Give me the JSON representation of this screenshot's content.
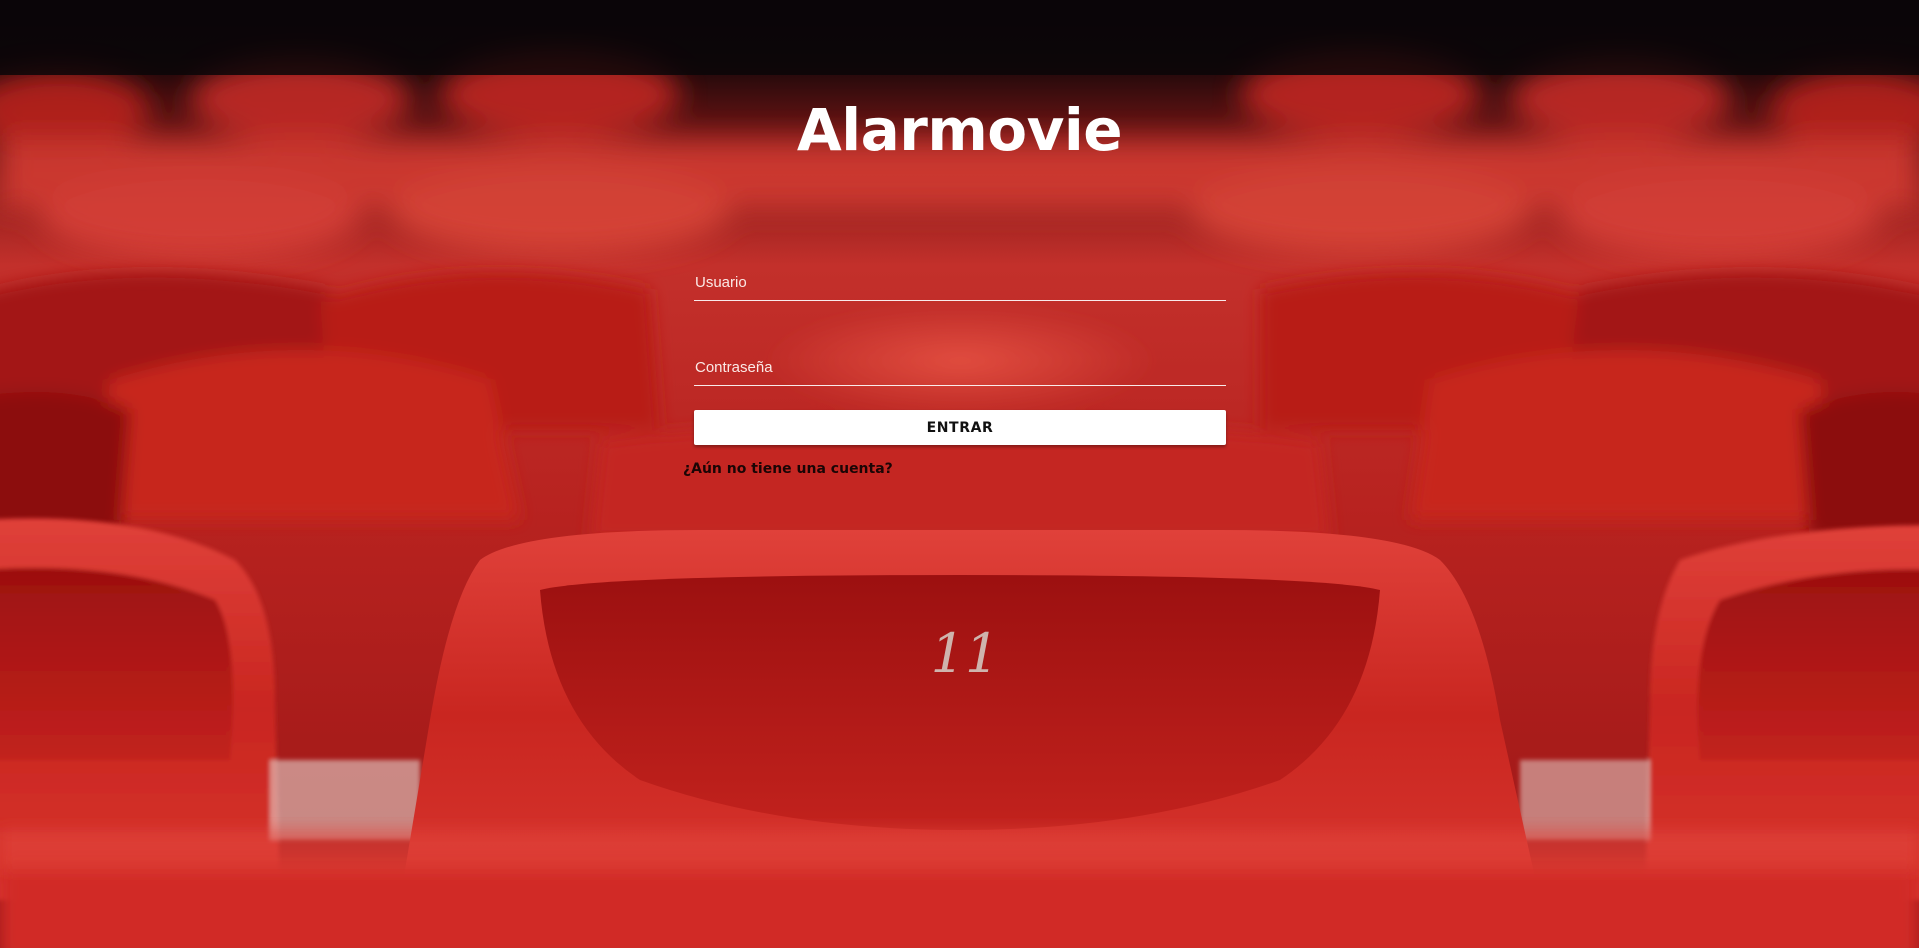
{
  "app": {
    "title": "Alarmovie"
  },
  "login_form": {
    "username_placeholder": "Usuario",
    "username_value": "",
    "password_placeholder": "Contraseña",
    "password_value": "",
    "submit_label": "ENTRAR",
    "signup_link": "¿Aún no tiene una cuenta?"
  },
  "background": {
    "description_seat_number": "11",
    "colors": {
      "seat_red": "#d42a24",
      "seat_dark": "#7a0d0d",
      "backdrop": "#0a0608"
    }
  }
}
